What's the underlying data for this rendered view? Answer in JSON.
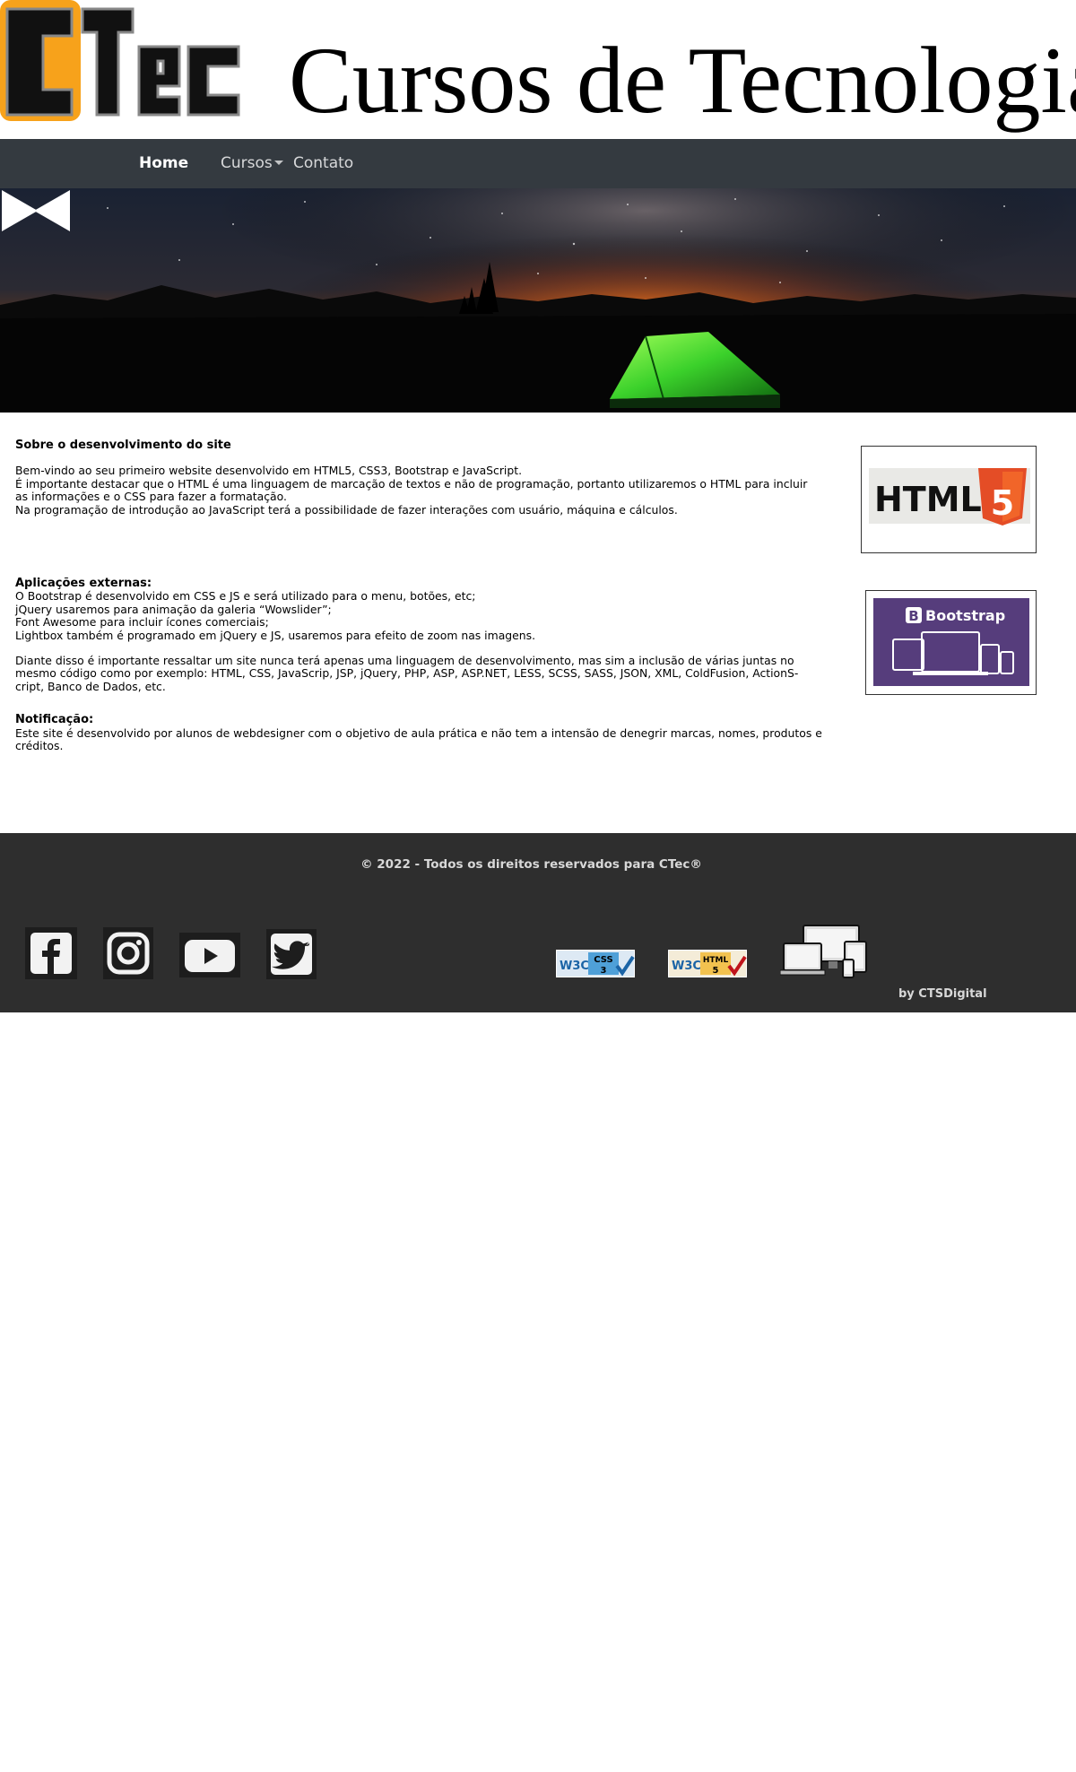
{
  "header": {
    "logo_text": "CTec",
    "title": "Cursos de Tecnologia"
  },
  "nav": {
    "home": "Home",
    "cursos": "Cursos",
    "contato": "Contato"
  },
  "main": {
    "section1_title": "Sobre o desenvolvimento do site",
    "section1_lines": [
      "Bem-vindo ao seu primeiro website desenvolvido em HTML5, CSS3, Bootstrap e JavaScript.",
      "É importante destacar que o HTML é uma linguagem de marcação de textos e não de programação, portanto utilizaremos o HTML para incluir as informações e o CSS para fazer a formatação.",
      "Na programação de introdução ao JavaScript terá a possibilidade de fazer interações com usuário, máquina e cálculos."
    ],
    "section2_title": "Aplicações externas:",
    "section2_lines": [
      "O Bootstrap é desenvolvido em CSS e JS e será utilizado para o menu, botões, etc;",
      "jQuery usaremos para animação da galeria “Wowslider”;",
      "Font Awesome para incluir ícones comerciais;",
      "Lightbox também é programado em jQuery e JS, usaremos para efeito de zoom nas imagens."
    ],
    "section2_extra": "Diante disso é importante ressaltar um site nunca terá apenas uma linguagem de desenvolvimento, mas sim a inclusão de várias juntas no mesmo código como por exemplo: HTML, CSS, JavaScrip, JSP, jQuery, PHP, ASP, ASP.NET, LESS, SCSS, SASS, JSON, XML, ColdFusion, ActionS-cript, Banco de Dados, etc.",
    "section3_title": "Notificação:",
    "section3_text": "Este site é desenvolvido por alunos de webdesigner com o objetivo de aula prática e não tem a intensão de denegrir marcas, nomes, produtos e créditos.",
    "html5_badge_text": "HTML",
    "html5_badge_num": "5",
    "bootstrap_badge_text": "Bootstrap",
    "bootstrap_badge_letter": "B"
  },
  "footer": {
    "copyright": "© 2022 - Todos os direitos reservados para CTec®",
    "byline": "by CTSDigital",
    "css_badge": "CSS",
    "css_badge_num": "3",
    "html_badge": "HTML",
    "html_badge_num": "5",
    "w3c": "W3C"
  },
  "icons": [
    "facebook-icon",
    "instagram-icon",
    "youtube-icon",
    "twitter-icon",
    "devices-icon"
  ],
  "colors": {
    "navbar": "#343a40",
    "footer": "#2e2e2e",
    "logo_orange": "#f7a21b",
    "html5_orange": "#e44d26",
    "bootstrap_purple": "#563d7c"
  }
}
